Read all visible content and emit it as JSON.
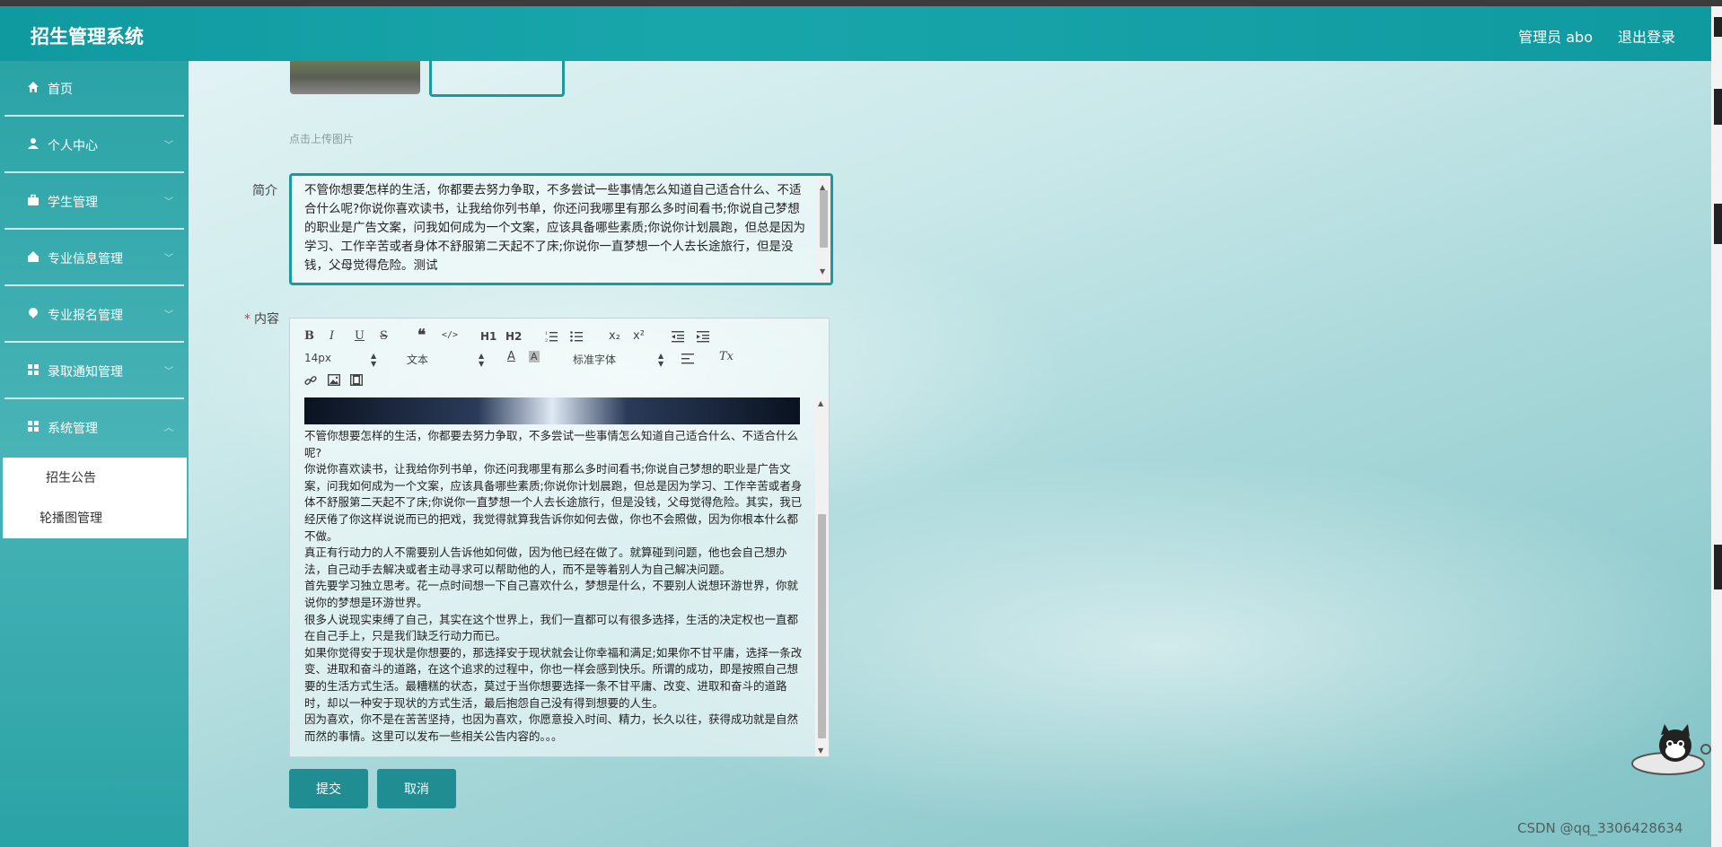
{
  "header": {
    "app_title": "招生管理系统",
    "admin_label": "管理员 abo",
    "logout_label": "退出登录"
  },
  "sidebar": {
    "items": [
      {
        "label": "首页",
        "icon": "home-icon"
      },
      {
        "label": "个人中心",
        "icon": "user-icon"
      },
      {
        "label": "学生管理",
        "icon": "briefcase-icon"
      },
      {
        "label": "专业信息管理",
        "icon": "gauge-icon"
      },
      {
        "label": "专业报名管理",
        "icon": "location-icon"
      },
      {
        "label": "录取通知管理",
        "icon": "grid-icon"
      },
      {
        "label": "系统管理",
        "icon": "grid-icon"
      }
    ],
    "submenu": [
      {
        "label": "招生公告"
      },
      {
        "label": "轮播图管理"
      }
    ]
  },
  "form": {
    "upload_tip": "点击上传图片",
    "intro_label": "简介",
    "intro_value": "不管你想要怎样的生活，你都要去努力争取，不多尝试一些事情怎么知道自己适合什么、不适合什么呢?你说你喜欢读书，让我给你列书单，你还问我哪里有那么多时间看书;你说自己梦想的职业是广告文案，问我如何成为一个文案，应该具备哪些素质;你说你计划晨跑，但总是因为学习、工作辛苦或者身体不舒服第二天起不了床;你说你一直梦想一个人去长途旅行，但是没钱，父母觉得危险。测试",
    "content_label": "内容",
    "content_paragraphs": [
      "不管你想要怎样的生活，你都要去努力争取，不多尝试一些事情怎么知道自己适合什么、不适合什么呢?",
      "你说你喜欢读书，让我给你列书单，你还问我哪里有那么多时间看书;你说自己梦想的职业是广告文案，问我如何成为一个文案，应该具备哪些素质;你说你计划晨跑，但总是因为学习、工作辛苦或者身体不舒服第二天起不了床;你说你一直梦想一个人去长途旅行，但是没钱，父母觉得危险。其实，我已经厌倦了你这样说说而已的把戏，我觉得就算我告诉你如何去做，你也不会照做，因为你根本什么都不做。",
      "真正有行动力的人不需要别人告诉他如何做，因为他已经在做了。就算碰到问题，他也会自己想办法，自己动手去解决或者主动寻求可以帮助他的人，而不是等着别人为自己解决问题。",
      "首先要学习独立思考。花一点时间想一下自己喜欢什么，梦想是什么，不要别人说想环游世界，你就说你的梦想是环游世界。",
      "很多人说现实束缚了自己，其实在这个世界上，我们一直都可以有很多选择，生活的决定权也一直都在自己手上，只是我们缺乏行动力而已。",
      "如果你觉得安于现状是你想要的，那选择安于现状就会让你幸福和满足;如果你不甘平庸，选择一条改变、进取和奋斗的道路，在这个追求的过程中，你也一样会感到快乐。所谓的成功，即是按照自己想要的生活方式生活。最糟糕的状态，莫过于当你想要选择一条不甘平庸、改变、进取和奋斗的道路时，却以一种安于现状的方式生活，最后抱怨自己没有得到想要的人生。",
      "因为喜欢，你不是在苦苦坚持，也因为喜欢，你愿意投入时间、精力，长久以往，获得成功就是自然而然的事情。这里可以发布一些相关公告内容的。。。"
    ]
  },
  "toolbar": {
    "font_size": "14px",
    "text_type": "文本",
    "font_family": "标准字体",
    "buttons": [
      "B",
      "I",
      "U",
      "S",
      "❝",
      "</>",
      "H1",
      "H2",
      "ol",
      "ul",
      "x₂",
      "x²",
      "outdent",
      "indent",
      "A",
      "bgA",
      "align",
      "Tx",
      "link",
      "image",
      "video"
    ]
  },
  "buttons": {
    "submit": "提交",
    "cancel": "取消"
  },
  "watermark": "CSDN @qq_3306428634"
}
